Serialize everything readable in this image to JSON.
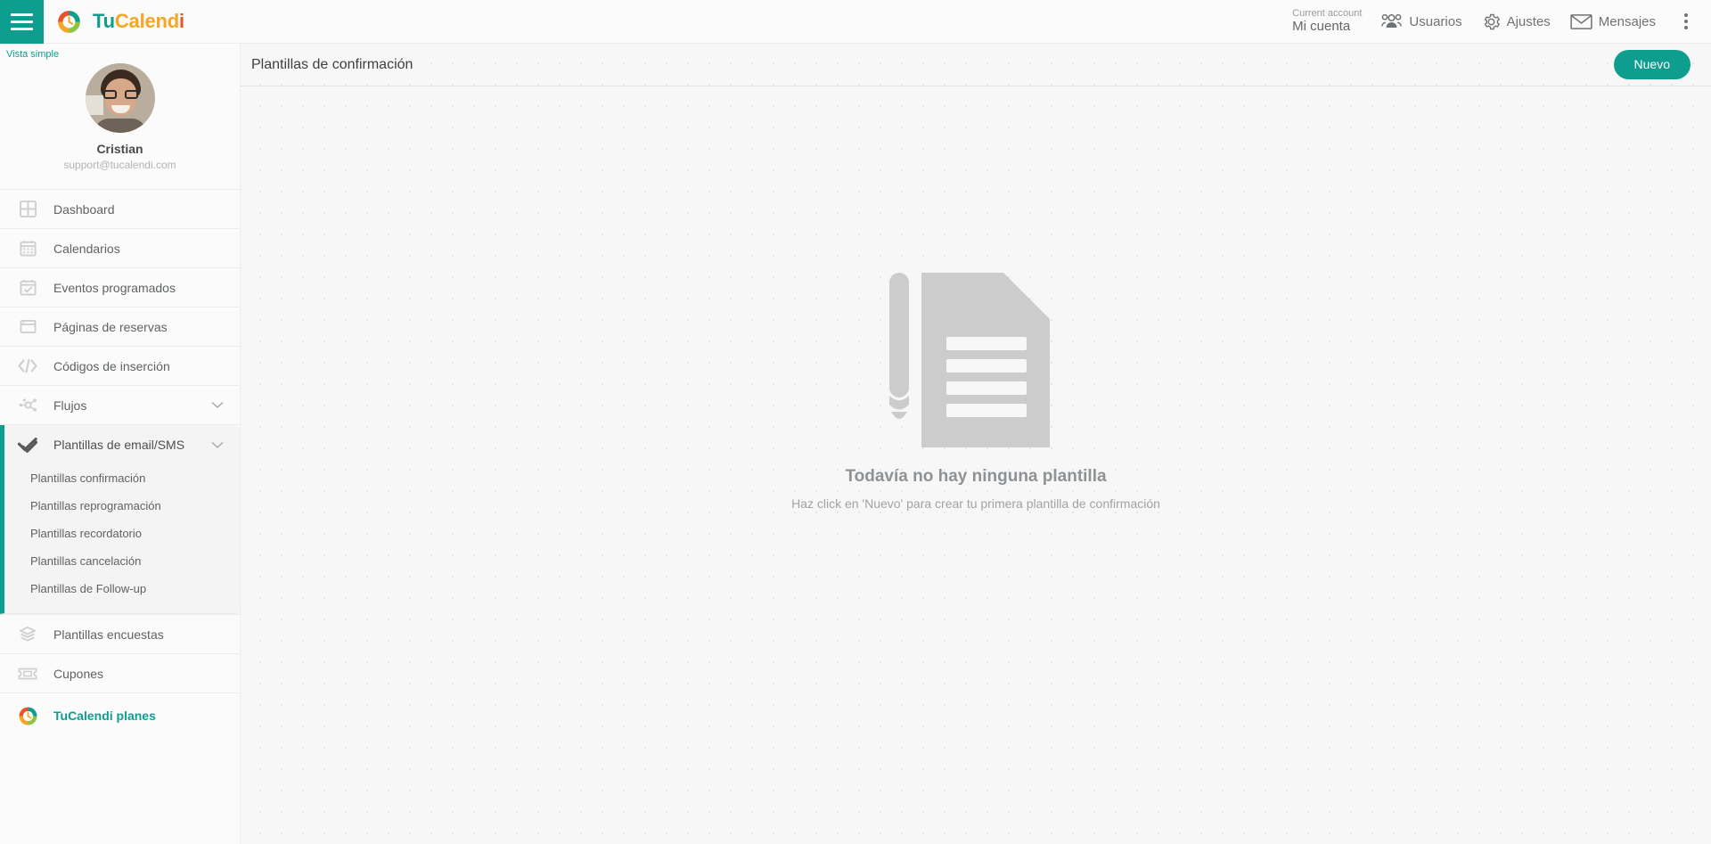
{
  "topbar": {
    "menu_icon": "hamburger-icon",
    "brand": {
      "part1": "Tu",
      "part2": "Calend",
      "part3": "i",
      "logo_icon": "tucalendi-logo-icon"
    },
    "account": {
      "caption": "Current account",
      "name": "Mi cuenta"
    },
    "nav": [
      {
        "label": "Usuarios",
        "icon": "users-icon"
      },
      {
        "label": "Ajustes",
        "icon": "gear-icon"
      },
      {
        "label": "Mensajes",
        "icon": "envelope-icon"
      }
    ],
    "more_icon": "kebab-menu-icon"
  },
  "sidebar": {
    "view_toggle": "Vista simple",
    "profile": {
      "name": "Cristian",
      "email": "support@tucalendi.com",
      "avatar": "user-avatar"
    },
    "items": [
      {
        "label": "Dashboard",
        "icon": "dashboard-grid-icon"
      },
      {
        "label": "Calendarios",
        "icon": "calendar-icon"
      },
      {
        "label": "Eventos programados",
        "icon": "calendar-check-icon"
      },
      {
        "label": "Páginas de reservas",
        "icon": "browser-window-icon"
      },
      {
        "label": "Códigos de inserción",
        "icon": "code-brackets-icon"
      },
      {
        "label": "Flujos",
        "icon": "flow-nodes-icon",
        "expandable": true
      },
      {
        "label": "Plantillas de email/SMS",
        "icon": "double-check-icon",
        "expandable": true,
        "active": true
      }
    ],
    "submenu": [
      {
        "label": "Plantillas confirmación"
      },
      {
        "label": "Plantillas reprogramación"
      },
      {
        "label": "Plantillas recordatorio"
      },
      {
        "label": "Plantillas cancelación"
      },
      {
        "label": "Plantillas de Follow-up"
      }
    ],
    "items_bottom": [
      {
        "label": "Plantillas encuestas",
        "icon": "layers-icon"
      },
      {
        "label": "Cupones",
        "icon": "ticket-icon"
      }
    ],
    "plans": {
      "label": "TuCalendi planes",
      "icon": "tucalendi-logo-icon"
    }
  },
  "main": {
    "title": "Plantillas de confirmación",
    "new_button": "Nuevo",
    "empty_state": {
      "illustration": "document-with-pencil-icon",
      "title": "Todavía no hay ninguna plantilla",
      "subtitle": "Haz click en 'Nuevo' para crear tu primera plantilla de confirmación"
    }
  },
  "colors": {
    "accent": "#0e9e8f",
    "brand_orange": "#f5a623",
    "brand_red": "#e8532b",
    "brand_green": "#8cc63f",
    "empty_gray": "#cccccc"
  }
}
